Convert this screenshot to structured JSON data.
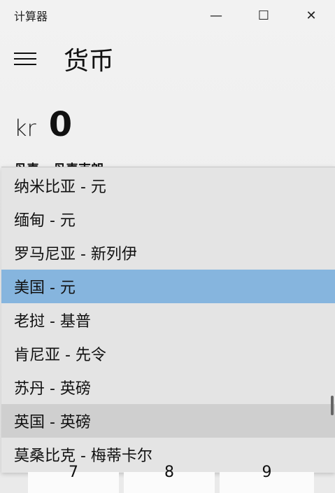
{
  "window": {
    "title": "计算器",
    "controls": {
      "minimize": "—",
      "maximize": "☐",
      "close": "✕"
    }
  },
  "header": {
    "menu_icon": "hamburger-menu-icon",
    "title": "货币"
  },
  "display": {
    "currency_symbol": "kr",
    "value": "0",
    "partial_label": "丹麦 - 丹麦克朗"
  },
  "dropdown": {
    "items": [
      {
        "label": "纳米比亚 - 元",
        "state": "normal"
      },
      {
        "label": "缅甸 - 元",
        "state": "normal"
      },
      {
        "label": "罗马尼亚 - 新列伊",
        "state": "normal"
      },
      {
        "label": "美国 - 元",
        "state": "selected"
      },
      {
        "label": "老挝 - 基普",
        "state": "normal"
      },
      {
        "label": "肯尼亚 - 先令",
        "state": "normal"
      },
      {
        "label": "苏丹 - 英磅",
        "state": "normal"
      },
      {
        "label": "英国 - 英磅",
        "state": "hover"
      },
      {
        "label": "莫桑比克 - 梅蒂卡尔",
        "state": "normal"
      }
    ]
  },
  "keypad_peek": {
    "keys": [
      "7",
      "8",
      "9"
    ]
  },
  "colors": {
    "selected_bg": "#86b5de",
    "hover_bg": "#cfcfcf",
    "dropdown_bg": "#e4e4e4"
  }
}
